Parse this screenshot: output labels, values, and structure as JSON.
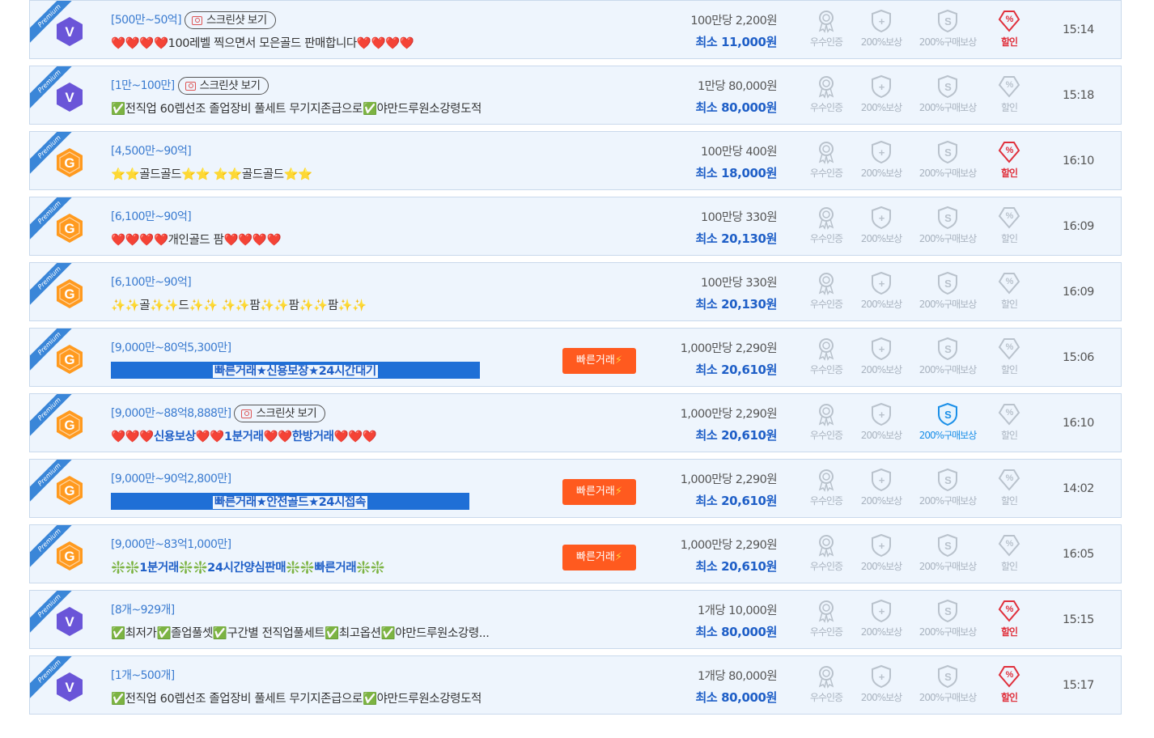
{
  "labels": {
    "ribbon": "Premium",
    "screenshot": "스크린샷 보기",
    "fast_trade": "빠른거래",
    "min_prefix": "최소",
    "cert": "우수인증",
    "comp": "200%보상",
    "buycomp": "200%구매보상",
    "discount": "할인"
  },
  "colors": {
    "v_badge": "#6a55d8",
    "g_badge": "#ff9a1f",
    "accent": "#1f5fc7",
    "fast": "#ff5a1f",
    "discount": "#e0303c"
  },
  "listings": [
    {
      "badge": "V",
      "range": "[500만~50억]",
      "screenshot": true,
      "title": "❤️❤️❤️❤️100레벨 찍으면서 모은골드 판매합니다❤️❤️❤️❤️",
      "style": "plain",
      "fast": false,
      "price": "100만당 2,200원",
      "min": "11,000원",
      "discount": true,
      "buycomp": false,
      "time": "15:14"
    },
    {
      "badge": "V",
      "range": "[1만~100만]",
      "screenshot": true,
      "title": "✅전직업 60렙선조 졸업장비 풀세트 무기지존급으로✅야만드루원소강령도적",
      "style": "plain",
      "fast": false,
      "price": "1만당 80,000원",
      "min": "80,000원",
      "discount": false,
      "buycomp": false,
      "time": "15:18"
    },
    {
      "badge": "G",
      "range": "[4,500만~90억]",
      "screenshot": false,
      "title": "⭐⭐골드골드⭐⭐ ⭐⭐골드골드⭐⭐",
      "style": "plain",
      "fast": false,
      "price": "100만당 400원",
      "min": "18,000원",
      "discount": true,
      "buycomp": false,
      "time": "16:10"
    },
    {
      "badge": "G",
      "range": "[6,100만~90억]",
      "screenshot": false,
      "title": "❤️❤️❤️❤️개인골드 팜❤️❤️❤️❤️",
      "style": "plain",
      "fast": false,
      "price": "100만당 330원",
      "min": "20,130원",
      "discount": false,
      "buycomp": false,
      "time": "16:09"
    },
    {
      "badge": "G",
      "range": "[6,100만~90억]",
      "screenshot": false,
      "title": "✨✨골✨✨드✨✨ ✨✨팜✨✨팜✨✨팜✨✨",
      "style": "plain",
      "fast": false,
      "price": "100만당 330원",
      "min": "20,130원",
      "discount": false,
      "buycomp": false,
      "time": "16:09"
    },
    {
      "badge": "G",
      "range": "[9,000만~80억5,300만]",
      "screenshot": false,
      "title": "빠른거래★신용보장★24시간대기",
      "style": "bar",
      "fast": true,
      "price": "1,000만당 2,290원",
      "min": "20,610원",
      "discount": false,
      "buycomp": false,
      "time": "15:06"
    },
    {
      "badge": "G",
      "range": "[9,000만~88억8,888만]",
      "screenshot": true,
      "title": "❤️❤️❤️신용보상❤️❤️1분거래❤️❤️한방거래❤️❤️❤️",
      "style": "bold",
      "fast": false,
      "price": "1,000만당 2,290원",
      "min": "20,610원",
      "discount": false,
      "buycomp": true,
      "time": "16:10"
    },
    {
      "badge": "G",
      "range": "[9,000만~90억2,800만]",
      "screenshot": false,
      "title": "빠른거래★안전골드★24시접속",
      "style": "bar",
      "fast": true,
      "price": "1,000만당 2,290원",
      "min": "20,610원",
      "discount": false,
      "buycomp": false,
      "time": "14:02"
    },
    {
      "badge": "G",
      "range": "[9,000만~83억1,000만]",
      "screenshot": false,
      "title": "❇️❇️1분거래❇️❇️24시간양심판매❇️❇️빠른거래❇️❇️",
      "style": "bold",
      "fast": true,
      "price": "1,000만당 2,290원",
      "min": "20,610원",
      "discount": false,
      "buycomp": false,
      "time": "16:05"
    },
    {
      "badge": "V",
      "range": "[8개~929개]",
      "screenshot": false,
      "title": "✅최저가✅졸업풀셋✅구간별 전직업풀세트✅최고옵션✅야만드루원소강령...",
      "style": "plain",
      "fast": false,
      "price": "1개당 10,000원",
      "min": "80,000원",
      "discount": true,
      "buycomp": false,
      "time": "15:15"
    },
    {
      "badge": "V",
      "range": "[1개~500개]",
      "screenshot": false,
      "title": "✅전직업 60렙선조 졸업장비 풀세트 무기지존급으로✅야만드루원소강령도적",
      "style": "plain",
      "fast": false,
      "price": "1개당 80,000원",
      "min": "80,000원",
      "discount": true,
      "buycomp": false,
      "time": "15:17"
    }
  ]
}
